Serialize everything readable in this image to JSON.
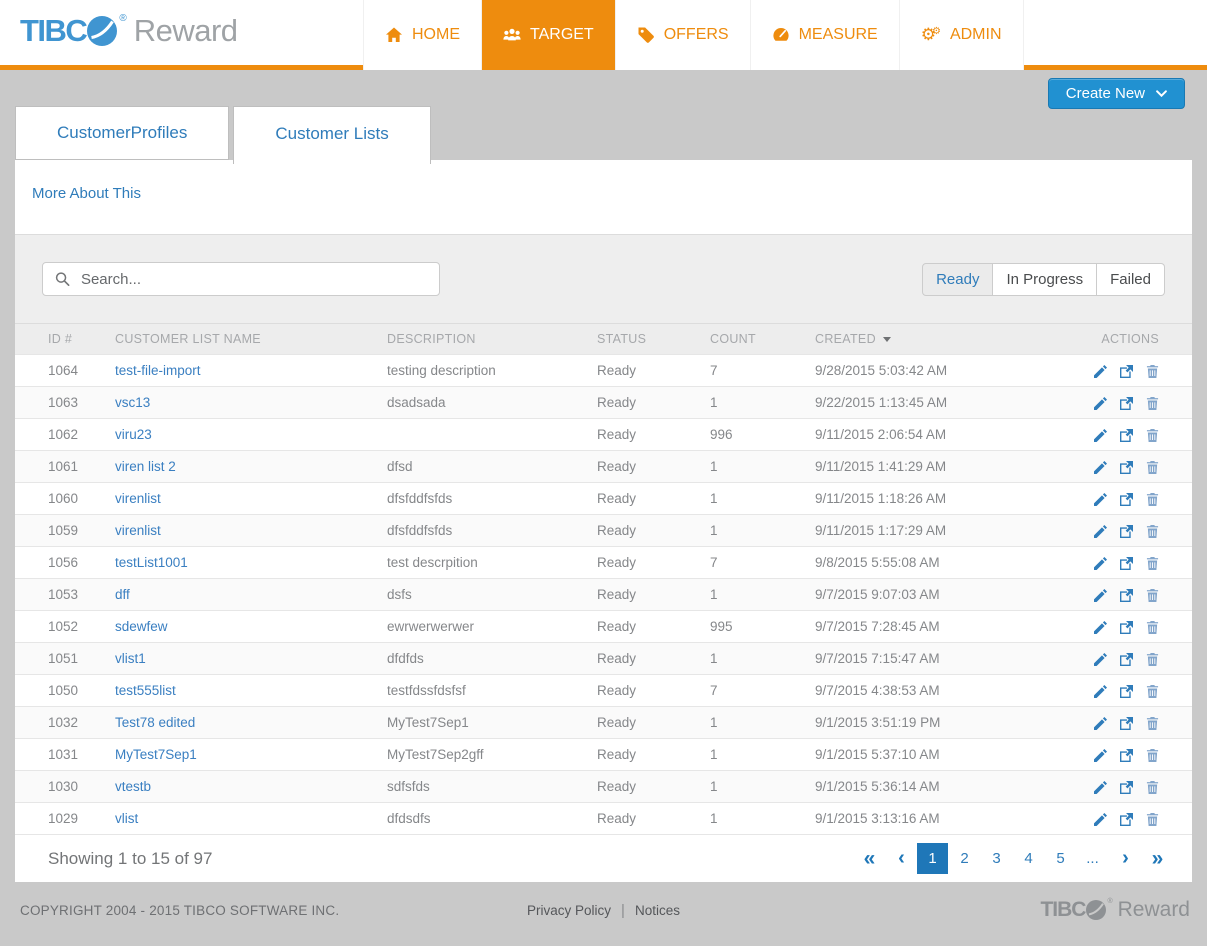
{
  "brand": {
    "tibc": "TIBC",
    "registered": "®",
    "reward": "Reward"
  },
  "nav": {
    "items": [
      {
        "label": "HOME",
        "icon": "home-icon",
        "active": false
      },
      {
        "label": "TARGET",
        "icon": "users-icon",
        "active": true
      },
      {
        "label": "OFFERS",
        "icon": "tags-icon",
        "active": false
      },
      {
        "label": "MEASURE",
        "icon": "gauge-icon",
        "active": false
      },
      {
        "label": "ADMIN",
        "icon": "gears-icon",
        "active": false
      }
    ]
  },
  "tabs": [
    {
      "label": "CustomerProfiles",
      "active": false
    },
    {
      "label": "Customer Lists",
      "active": true
    }
  ],
  "create_new": {
    "label": "Create New",
    "icon": "chevron-down-icon"
  },
  "about_link": "More About This",
  "search": {
    "placeholder": "Search...",
    "value": "",
    "icon": "search-icon"
  },
  "filters": [
    {
      "label": "Ready",
      "active": true
    },
    {
      "label": "In Progress",
      "active": false
    },
    {
      "label": "Failed",
      "active": false
    }
  ],
  "table": {
    "columns": {
      "id": "ID #",
      "name": "CUSTOMER LIST NAME",
      "description": "DESCRIPTION",
      "status": "STATUS",
      "count": "COUNT",
      "created": "CREATED",
      "actions": "ACTIONS"
    },
    "sorted_by": "CREATED",
    "sort_direction": "desc",
    "row_actions": [
      "edit-icon",
      "export-icon",
      "delete-icon"
    ],
    "rows": [
      {
        "id": "1064",
        "name": "test-file-import",
        "description": "testing description",
        "status": "Ready",
        "count": "7",
        "created": "9/28/2015 5:03:42 AM"
      },
      {
        "id": "1063",
        "name": "vsc13",
        "description": "dsadsada",
        "status": "Ready",
        "count": "1",
        "created": "9/22/2015 1:13:45 AM"
      },
      {
        "id": "1062",
        "name": "viru23",
        "description": "",
        "status": "Ready",
        "count": "996",
        "created": "9/11/2015 2:06:54 AM"
      },
      {
        "id": "1061",
        "name": "viren list 2",
        "description": "dfsd",
        "status": "Ready",
        "count": "1",
        "created": "9/11/2015 1:41:29 AM"
      },
      {
        "id": "1060",
        "name": "virenlist",
        "description": "dfsfddfsfds",
        "status": "Ready",
        "count": "1",
        "created": "9/11/2015 1:18:26 AM"
      },
      {
        "id": "1059",
        "name": "virenlist",
        "description": "dfsfddfsfds",
        "status": "Ready",
        "count": "1",
        "created": "9/11/2015 1:17:29 AM"
      },
      {
        "id": "1056",
        "name": "testList1001",
        "description": "test descrpition",
        "status": "Ready",
        "count": "7",
        "created": "9/8/2015 5:55:08 AM"
      },
      {
        "id": "1053",
        "name": "dff",
        "description": "dsfs",
        "status": "Ready",
        "count": "1",
        "created": "9/7/2015 9:07:03 AM"
      },
      {
        "id": "1052",
        "name": "sdewfew",
        "description": "ewrwerwerwer",
        "status": "Ready",
        "count": "995",
        "created": "9/7/2015 7:28:45 AM"
      },
      {
        "id": "1051",
        "name": "vlist1",
        "description": "dfdfds",
        "status": "Ready",
        "count": "1",
        "created": "9/7/2015 7:15:47 AM"
      },
      {
        "id": "1050",
        "name": "test555list",
        "description": "testfdssfdsfsf",
        "status": "Ready",
        "count": "7",
        "created": "9/7/2015 4:38:53 AM"
      },
      {
        "id": "1032",
        "name": "Test78 edited",
        "description": "MyTest7Sep1",
        "status": "Ready",
        "count": "1",
        "created": "9/1/2015 3:51:19 PM"
      },
      {
        "id": "1031",
        "name": "MyTest7Sep1",
        "description": "MyTest7Sep2gff",
        "status": "Ready",
        "count": "1",
        "created": "9/1/2015 5:37:10 AM"
      },
      {
        "id": "1030",
        "name": "vtestb",
        "description": "sdfsfds",
        "status": "Ready",
        "count": "1",
        "created": "9/1/2015 5:36:14 AM"
      },
      {
        "id": "1029",
        "name": "vlist",
        "description": "dfdsdfs",
        "status": "Ready",
        "count": "1",
        "created": "9/1/2015 3:13:16 AM"
      }
    ]
  },
  "pagination": {
    "summary": "Showing 1 to 15 of 97",
    "first": "«",
    "prev": "‹",
    "next": "›",
    "last": "»",
    "pages": [
      "1",
      "2",
      "3",
      "4",
      "5",
      "..."
    ],
    "active_page": "1"
  },
  "footer": {
    "copyright": "COPYRIGHT 2004 - 2015 TIBCO SOFTWARE INC.",
    "links": [
      "Privacy Policy",
      "Notices"
    ],
    "separator": "|"
  },
  "colors": {
    "accent_orange": "#EE8C0E",
    "brand_blue": "#4095D1",
    "brand_gray": "#9FA3A6",
    "link_blue": "#2F7CBA",
    "button_blue": "#2191D1",
    "pagination_blue": "#1F77B8",
    "page_background": "#C9C9C9",
    "toolbar_background": "#EEEEEE"
  }
}
